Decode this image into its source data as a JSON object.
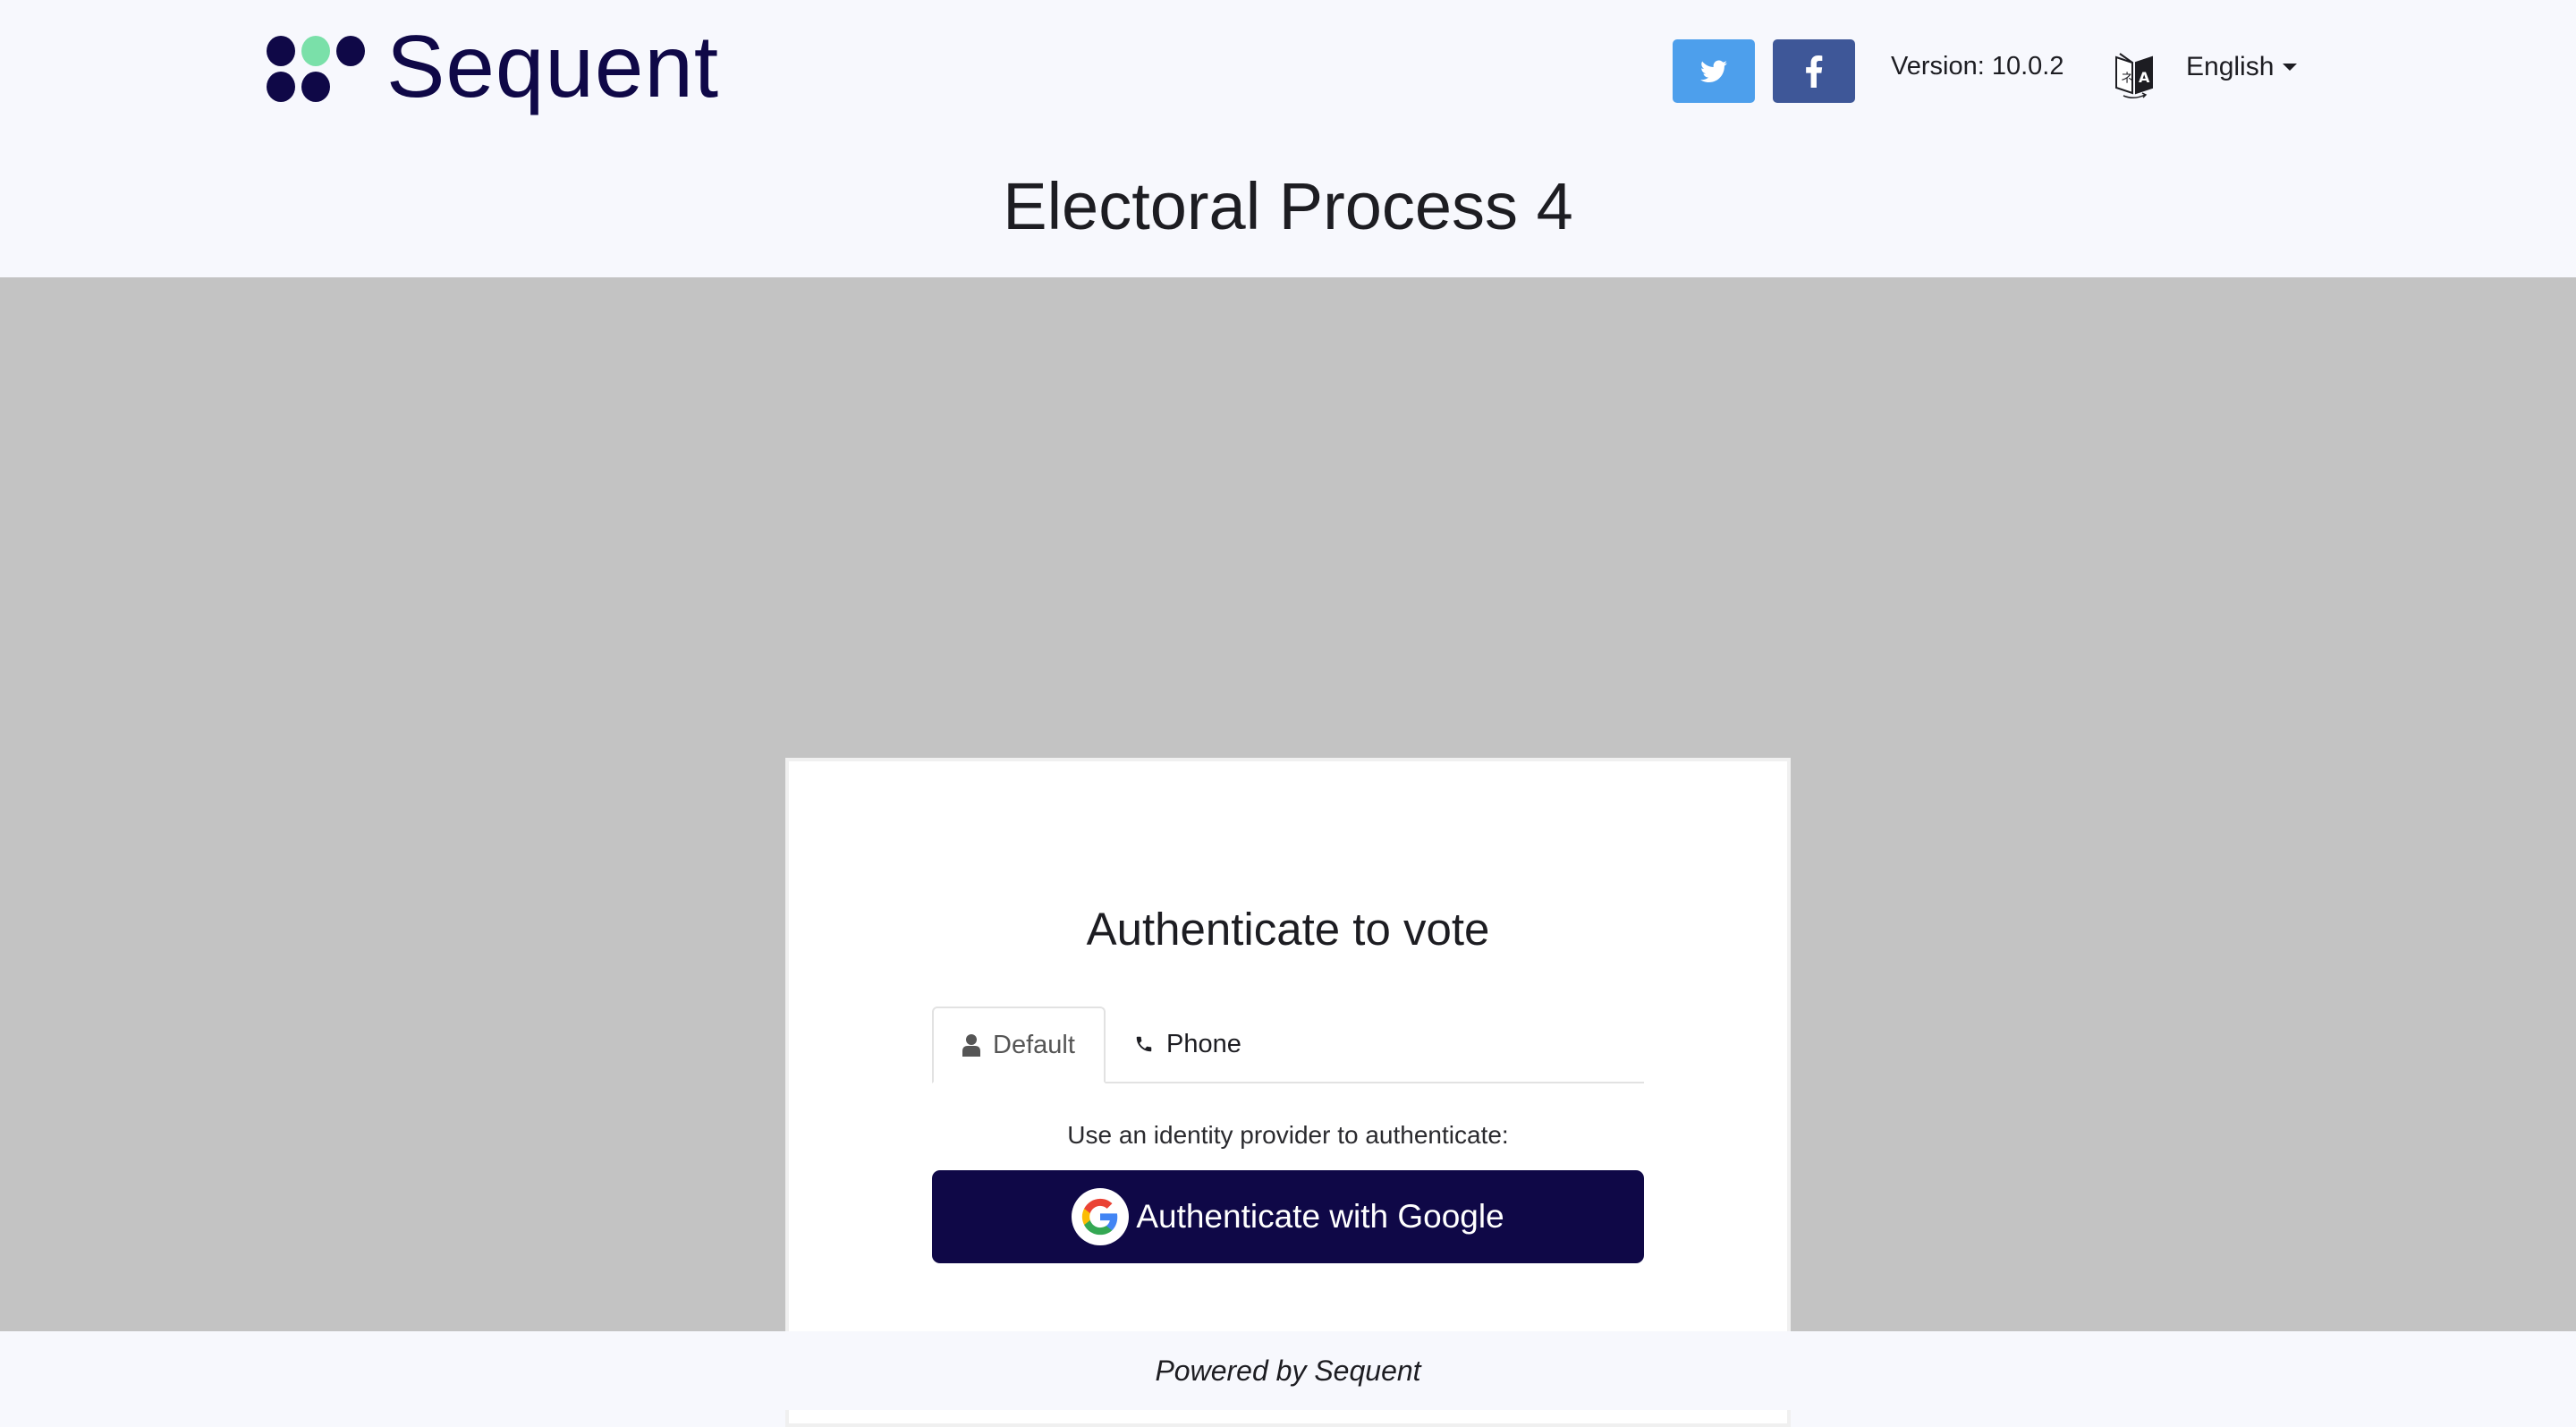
{
  "header": {
    "logo_text": "Sequent",
    "logo_colors": {
      "primary": "#0f0847",
      "accent": "#7ae0a9"
    },
    "social": [
      {
        "name": "twitter",
        "icon": "twitter-icon",
        "color": "#4d9fec"
      },
      {
        "name": "facebook",
        "icon": "facebook-icon",
        "color": "#3e5798"
      }
    ],
    "version_label": "Version: 10.0.2",
    "language": {
      "icon": "translate-icon",
      "selected": "English"
    }
  },
  "page_title": "Electoral Process 4",
  "auth_card": {
    "title": "Authenticate to vote",
    "tabs": [
      {
        "label": "Default",
        "icon": "user-icon",
        "active": true
      },
      {
        "label": "Phone",
        "icon": "phone-icon",
        "active": false
      }
    ],
    "helper_text": "Use an identity provider to authenticate:",
    "google_button": {
      "label": "Authenticate with Google",
      "icon": "google-icon",
      "color": "#0f0847"
    }
  },
  "footer": {
    "text": "Powered by Sequent"
  }
}
